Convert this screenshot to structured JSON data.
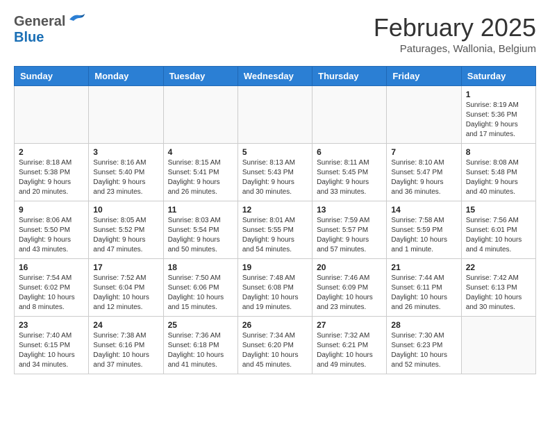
{
  "header": {
    "logo_general": "General",
    "logo_blue": "Blue",
    "month_year": "February 2025",
    "location": "Paturages, Wallonia, Belgium"
  },
  "weekdays": [
    "Sunday",
    "Monday",
    "Tuesday",
    "Wednesday",
    "Thursday",
    "Friday",
    "Saturday"
  ],
  "weeks": [
    [
      {
        "day": "",
        "info": ""
      },
      {
        "day": "",
        "info": ""
      },
      {
        "day": "",
        "info": ""
      },
      {
        "day": "",
        "info": ""
      },
      {
        "day": "",
        "info": ""
      },
      {
        "day": "",
        "info": ""
      },
      {
        "day": "1",
        "info": "Sunrise: 8:19 AM\nSunset: 5:36 PM\nDaylight: 9 hours and 17 minutes."
      }
    ],
    [
      {
        "day": "2",
        "info": "Sunrise: 8:18 AM\nSunset: 5:38 PM\nDaylight: 9 hours and 20 minutes."
      },
      {
        "day": "3",
        "info": "Sunrise: 8:16 AM\nSunset: 5:40 PM\nDaylight: 9 hours and 23 minutes."
      },
      {
        "day": "4",
        "info": "Sunrise: 8:15 AM\nSunset: 5:41 PM\nDaylight: 9 hours and 26 minutes."
      },
      {
        "day": "5",
        "info": "Sunrise: 8:13 AM\nSunset: 5:43 PM\nDaylight: 9 hours and 30 minutes."
      },
      {
        "day": "6",
        "info": "Sunrise: 8:11 AM\nSunset: 5:45 PM\nDaylight: 9 hours and 33 minutes."
      },
      {
        "day": "7",
        "info": "Sunrise: 8:10 AM\nSunset: 5:47 PM\nDaylight: 9 hours and 36 minutes."
      },
      {
        "day": "8",
        "info": "Sunrise: 8:08 AM\nSunset: 5:48 PM\nDaylight: 9 hours and 40 minutes."
      }
    ],
    [
      {
        "day": "9",
        "info": "Sunrise: 8:06 AM\nSunset: 5:50 PM\nDaylight: 9 hours and 43 minutes."
      },
      {
        "day": "10",
        "info": "Sunrise: 8:05 AM\nSunset: 5:52 PM\nDaylight: 9 hours and 47 minutes."
      },
      {
        "day": "11",
        "info": "Sunrise: 8:03 AM\nSunset: 5:54 PM\nDaylight: 9 hours and 50 minutes."
      },
      {
        "day": "12",
        "info": "Sunrise: 8:01 AM\nSunset: 5:55 PM\nDaylight: 9 hours and 54 minutes."
      },
      {
        "day": "13",
        "info": "Sunrise: 7:59 AM\nSunset: 5:57 PM\nDaylight: 9 hours and 57 minutes."
      },
      {
        "day": "14",
        "info": "Sunrise: 7:58 AM\nSunset: 5:59 PM\nDaylight: 10 hours and 1 minute."
      },
      {
        "day": "15",
        "info": "Sunrise: 7:56 AM\nSunset: 6:01 PM\nDaylight: 10 hours and 4 minutes."
      }
    ],
    [
      {
        "day": "16",
        "info": "Sunrise: 7:54 AM\nSunset: 6:02 PM\nDaylight: 10 hours and 8 minutes."
      },
      {
        "day": "17",
        "info": "Sunrise: 7:52 AM\nSunset: 6:04 PM\nDaylight: 10 hours and 12 minutes."
      },
      {
        "day": "18",
        "info": "Sunrise: 7:50 AM\nSunset: 6:06 PM\nDaylight: 10 hours and 15 minutes."
      },
      {
        "day": "19",
        "info": "Sunrise: 7:48 AM\nSunset: 6:08 PM\nDaylight: 10 hours and 19 minutes."
      },
      {
        "day": "20",
        "info": "Sunrise: 7:46 AM\nSunset: 6:09 PM\nDaylight: 10 hours and 23 minutes."
      },
      {
        "day": "21",
        "info": "Sunrise: 7:44 AM\nSunset: 6:11 PM\nDaylight: 10 hours and 26 minutes."
      },
      {
        "day": "22",
        "info": "Sunrise: 7:42 AM\nSunset: 6:13 PM\nDaylight: 10 hours and 30 minutes."
      }
    ],
    [
      {
        "day": "23",
        "info": "Sunrise: 7:40 AM\nSunset: 6:15 PM\nDaylight: 10 hours and 34 minutes."
      },
      {
        "day": "24",
        "info": "Sunrise: 7:38 AM\nSunset: 6:16 PM\nDaylight: 10 hours and 37 minutes."
      },
      {
        "day": "25",
        "info": "Sunrise: 7:36 AM\nSunset: 6:18 PM\nDaylight: 10 hours and 41 minutes."
      },
      {
        "day": "26",
        "info": "Sunrise: 7:34 AM\nSunset: 6:20 PM\nDaylight: 10 hours and 45 minutes."
      },
      {
        "day": "27",
        "info": "Sunrise: 7:32 AM\nSunset: 6:21 PM\nDaylight: 10 hours and 49 minutes."
      },
      {
        "day": "28",
        "info": "Sunrise: 7:30 AM\nSunset: 6:23 PM\nDaylight: 10 hours and 52 minutes."
      },
      {
        "day": "",
        "info": ""
      }
    ]
  ]
}
